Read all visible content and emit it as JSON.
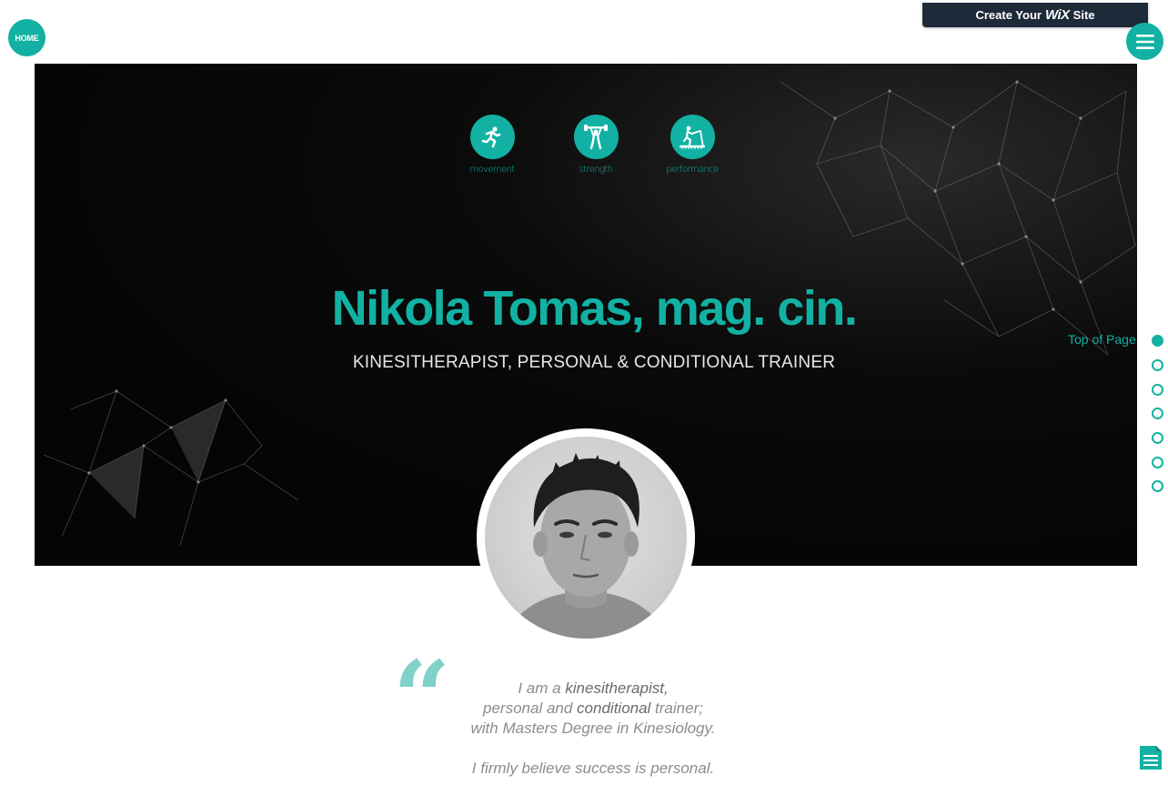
{
  "header": {
    "home_label": "HOME",
    "wix_banner": {
      "prefix": "Create Your",
      "logo": "WiX",
      "suffix": "Site"
    },
    "menu_icon": "hamburger-icon"
  },
  "hero": {
    "services": [
      {
        "label": "movement",
        "icon": "running-person-icon"
      },
      {
        "label": "strength",
        "icon": "weightlifter-icon"
      },
      {
        "label": "performance",
        "icon": "treadmill-icon"
      }
    ],
    "title": "Nikola Tomas, mag. cin.",
    "subtitle": "KINESITHERAPIST, PERSONAL & CONDITIONAL TRAINER"
  },
  "quote": {
    "line1_pre": "I am a ",
    "line1_hl": "kinesitherapist,",
    "line2_pre": "personal and ",
    "line2_hl": "conditional",
    "line2_post": " trainer;",
    "line3": "with Masters Degree in Kinesiology.",
    "line4": "I firmly believe success is personal."
  },
  "side_nav": {
    "tooltip": "Top of Page",
    "dots": 7,
    "active_index": 0
  },
  "colors": {
    "accent": "#12b1a3",
    "hero_bg": "#050505",
    "banner_bg": "#1d2a39"
  }
}
